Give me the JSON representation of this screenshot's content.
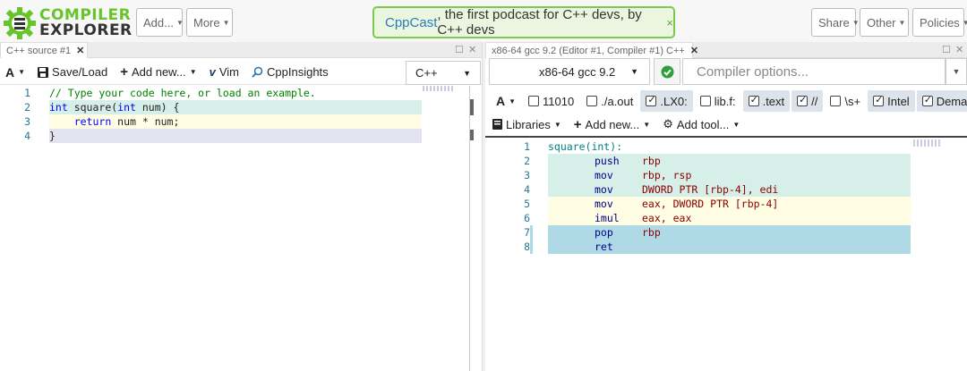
{
  "header": {
    "logo_line1": "COMPILER",
    "logo_line2": "EXPLORER",
    "add_label": "Add...",
    "more_label": "More",
    "share_label": "Share",
    "other_label": "Other",
    "policies_label": "Policies",
    "news": {
      "link": "CppCast",
      "text": ", the first podcast for C++ devs, by C++ devs",
      "close": "×"
    }
  },
  "source_pane": {
    "tab_title": "C++ source #1",
    "tab_close": "✕",
    "toolbar": {
      "font_label": "A",
      "save_label": "Save/Load",
      "addnew_label": "Add new...",
      "vim_label": "Vim",
      "cppinsights_label": "CppInsights",
      "language": "C++"
    },
    "lines": [
      {
        "n": "1",
        "text": "// Type your code here, or load an example."
      },
      {
        "n": "2",
        "text": "int square(int num) {"
      },
      {
        "n": "3",
        "text": "    return num * num;"
      },
      {
        "n": "4",
        "text": "}"
      }
    ]
  },
  "compiler_pane": {
    "tab_title": "x86-64 gcc 9.2 (Editor #1, Compiler #1) C++",
    "tab_close": "✕",
    "compiler": "x86-64 gcc 9.2",
    "options_placeholder": "Compiler options...",
    "filters": [
      {
        "label": "11010",
        "checked": false
      },
      {
        "label": "./a.out",
        "checked": false
      },
      {
        "label": ".LX0:",
        "checked": true
      },
      {
        "label": "lib.f:",
        "checked": false
      },
      {
        "label": ".text",
        "checked": true
      },
      {
        "label": "//",
        "checked": true
      },
      {
        "label": "\\s+",
        "checked": false
      },
      {
        "label": "Intel",
        "checked": true
      },
      {
        "label": "Demangle",
        "checked": true
      }
    ],
    "libraries_label": "Libraries",
    "addnew_label": "Add new...",
    "addtool_label": "Add tool...",
    "asm": [
      {
        "n": "1",
        "label": "square(int):",
        "op": "",
        "args": ""
      },
      {
        "n": "2",
        "label": "",
        "op": "push",
        "args": "rbp"
      },
      {
        "n": "3",
        "label": "",
        "op": "mov",
        "args": "rbp, rsp"
      },
      {
        "n": "4",
        "label": "",
        "op": "mov",
        "args": "DWORD PTR [rbp-4], edi"
      },
      {
        "n": "5",
        "label": "",
        "op": "mov",
        "args": "eax, DWORD PTR [rbp-4]"
      },
      {
        "n": "6",
        "label": "",
        "op": "imul",
        "args": "eax, eax"
      },
      {
        "n": "7",
        "label": "",
        "op": "pop",
        "args": "rbp"
      },
      {
        "n": "8",
        "label": "",
        "op": "ret",
        "args": ""
      }
    ]
  },
  "colors": {
    "brand_green": "#67c52a",
    "line_green": "#d6efe8",
    "line_yellow": "#fffde3",
    "line_blue": "#b0d9e6",
    "line_purple": "#e3e3ef",
    "keyword": "#0000ff",
    "comment": "#008000"
  }
}
